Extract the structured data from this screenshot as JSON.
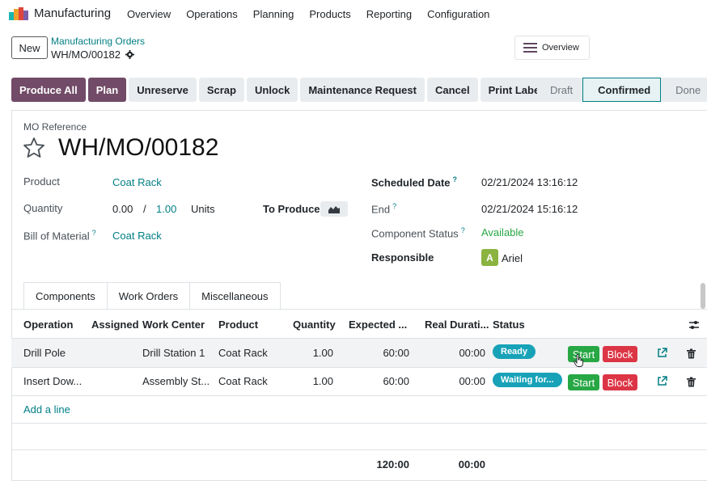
{
  "app": {
    "name": "Manufacturing",
    "menu": [
      "Overview",
      "Operations",
      "Planning",
      "Products",
      "Reporting",
      "Configuration"
    ]
  },
  "control_panel": {
    "new_label": "New",
    "breadcrumb_parent": "Manufacturing Orders",
    "breadcrumb_current": "WH/MO/00182",
    "overview_label": "Overview"
  },
  "actions": [
    "Produce All",
    "Plan",
    "Unreserve",
    "Scrap",
    "Unlock",
    "Maintenance Request",
    "Cancel",
    "Print Labels"
  ],
  "statusbar": {
    "stages": [
      "Draft",
      "Confirmed",
      "Done"
    ],
    "active": "Confirmed"
  },
  "form": {
    "ref_label": "MO Reference",
    "ref_value": "WH/MO/00182",
    "product_label": "Product",
    "product_value": "Coat Rack",
    "quantity_label": "Quantity",
    "quantity_produced": "0.00",
    "quantity_sep": "/",
    "quantity_total": "1.00",
    "quantity_uom": "Units",
    "to_produce_label": "To Produce",
    "bom_label": "Bill of Material",
    "bom_value": "Coat Rack",
    "help_mark": "?",
    "scheduled_label": "Scheduled Date",
    "scheduled_value": "02/21/2024 13:16:12",
    "end_label": "End",
    "end_value": "02/21/2024 15:16:12",
    "component_status_label": "Component Status",
    "component_status_value": "Available",
    "responsible_label": "Responsible",
    "responsible_initial": "A",
    "responsible_name": "Ariel"
  },
  "tabs": [
    "Components",
    "Work Orders",
    "Miscellaneous"
  ],
  "active_tab": "Work Orders",
  "table": {
    "headers": [
      "Operation",
      "Assigned",
      "Work Center",
      "Product",
      "Quantity",
      "Expected ...",
      "Real Durati...",
      "Status"
    ],
    "rows": [
      {
        "operation": "Drill Pole",
        "assigned": "",
        "work_center": "Drill Station 1",
        "product": "Coat Rack",
        "quantity": "1.00",
        "expected": "60:00",
        "real": "00:00",
        "status": "Ready",
        "start": "Start",
        "block": "Block"
      },
      {
        "operation": "Insert Dow...",
        "assigned": "",
        "work_center": "Assembly St...",
        "product": "Coat Rack",
        "quantity": "1.00",
        "expected": "60:00",
        "real": "00:00",
        "status": "Waiting for...",
        "start": "Start",
        "block": "Block"
      }
    ],
    "add_line": "Add a line",
    "total_expected": "120:00",
    "total_real": "00:00"
  },
  "colors": {
    "primary": "#714b67",
    "link": "#017e84",
    "start": "#28a745",
    "block": "#dc3545",
    "badge": "#17a2b8",
    "available": "#28a745"
  }
}
